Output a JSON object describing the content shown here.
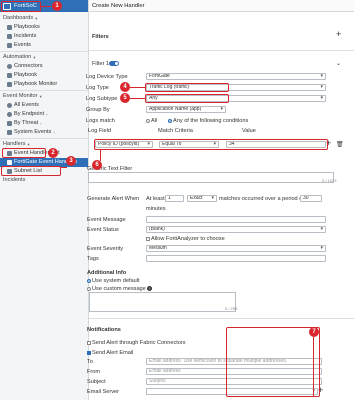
{
  "sidebar": {
    "brand": "FortiSoC",
    "items": [
      {
        "label": "Dashboards",
        "type": "section"
      },
      {
        "label": "Playbooks",
        "type": "sub"
      },
      {
        "label": "Incidents",
        "type": "sub"
      },
      {
        "label": "Events",
        "type": "sub"
      },
      {
        "label": "Automation",
        "type": "section"
      },
      {
        "label": "Connectors",
        "type": "sub"
      },
      {
        "label": "Playbook",
        "type": "sub"
      },
      {
        "label": "Playbook Monitor",
        "type": "sub"
      },
      {
        "label": "Event Monitor",
        "type": "section"
      },
      {
        "label": "All Events",
        "type": "sub"
      },
      {
        "label": "By Endpoint",
        "type": "sub"
      },
      {
        "label": "By Threat",
        "type": "sub"
      },
      {
        "label": "System Events",
        "type": "sub"
      },
      {
        "label": "Handlers",
        "type": "section"
      },
      {
        "label": "Event Handler List",
        "type": "sub"
      },
      {
        "label": "FortiGate Event Handlers",
        "type": "sub"
      },
      {
        "label": "Subnet List",
        "type": "sub"
      },
      {
        "label": "Incidents",
        "type": "section"
      }
    ]
  },
  "panel": {
    "title": "Create New Handler",
    "filters_label": "Filters",
    "filter1_label": "Filter 1",
    "toggle_label": "ON",
    "log_device_type_label": "Log Device Type",
    "log_device_type_value": "FortiGate",
    "log_type_label": "Log Type",
    "log_type_value": "Traffic Log (traffic)",
    "log_subtype_label": "Log Subtype",
    "log_subtype_value": "Any",
    "group_by_label": "Group By",
    "group_by_value": "Application Name (app)",
    "logs_match_label": "Logs match",
    "logs_match_all": "All",
    "logs_match_any": "Any of the following conditions",
    "col_log_field": "Log Field",
    "col_match_criteria": "Match Criteria",
    "col_value": "Value",
    "cond_field": "Policy ID (policyid)",
    "cond_match": "Equal To",
    "cond_value": "34",
    "generic_filter_label": "Generic Text Filter",
    "generic_counter": "0 / 1023",
    "gen_alert_label": "Generate Alert When",
    "at_least": "At least",
    "at_least_value": "1",
    "exact_value": "Exact",
    "matches_text": "matches occurred over a period of",
    "period_value": "30",
    "minutes_text": "minutes",
    "event_message_label": "Event Message",
    "event_status_label": "Event Status",
    "event_status_value": "(Blank)",
    "allow_fa_label": "Allow FortiAnalyzer to choose",
    "event_severity_label": "Event Severity",
    "event_severity_value": "Medium",
    "tags_label": "Tags",
    "additional_info_label": "Additional Info",
    "use_system_default": "Use system default",
    "use_custom_message": "Use custom message",
    "custom_counter": "0 / 255",
    "notifications_label": "Notifications",
    "send_fabric_label": "Send Alert through Fabric Connectors",
    "send_email_label": "Send Alert Email",
    "to_label": "To",
    "to_placeholder": "Email address. Use semicolon to separate multiple addresses.",
    "from_label": "From",
    "from_placeholder": "Email address",
    "subject_label": "Subject",
    "subject_placeholder": "Subject",
    "email_server_label": "Email Server"
  },
  "annotations": [
    "1",
    "2",
    "3",
    "4",
    "5",
    "6",
    "7"
  ],
  "colors": {
    "accent": "#2f6fb7",
    "annotation": "#d9262c"
  }
}
